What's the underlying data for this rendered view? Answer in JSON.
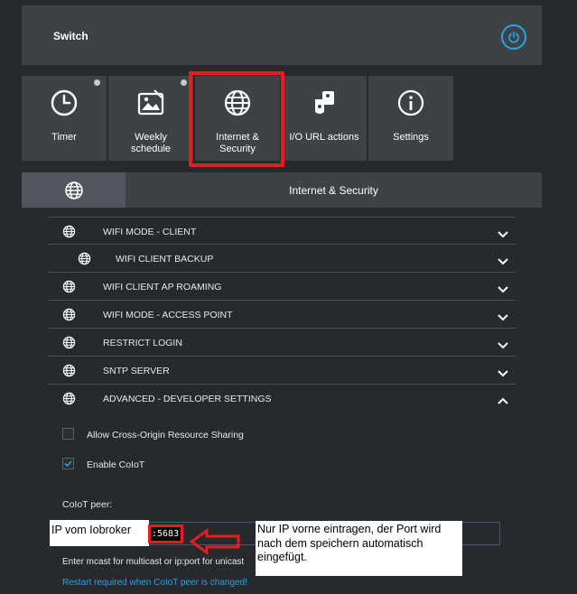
{
  "header": {
    "title": "Switch"
  },
  "tabs": [
    {
      "label": "Timer",
      "icon": "clock-icon",
      "dot": true
    },
    {
      "label": "Weekly schedule",
      "icon": "calendar-image-icon",
      "dot": true
    },
    {
      "label": "Internet & Security",
      "icon": "globe-icon",
      "dot": false,
      "active": true
    },
    {
      "label": "I/O URL actions",
      "icon": "io-url-icon",
      "dot": false
    },
    {
      "label": "Settings",
      "icon": "info-icon",
      "dot": false
    }
  ],
  "section": {
    "title": "Internet & Security",
    "icon": "globe-icon"
  },
  "rows": [
    {
      "label": "WIFI MODE - CLIENT",
      "chevron": "down"
    },
    {
      "label": "WIFI CLIENT BACKUP",
      "chevron": "down",
      "sub": true
    },
    {
      "label": "WIFI CLIENT AP ROAMING",
      "chevron": "down"
    },
    {
      "label": "WIFI MODE - ACCESS POINT",
      "chevron": "down"
    },
    {
      "label": "RESTRICT LOGIN",
      "chevron": "down"
    },
    {
      "label": "SNTP SERVER",
      "chevron": "down"
    },
    {
      "label": "ADVANCED - DEVELOPER SETTINGS",
      "chevron": "up"
    }
  ],
  "advanced": {
    "cors_label": "Allow Cross-Origin Resource Sharing",
    "cors_checked": false,
    "coiot_label": "Enable CoIoT",
    "coiot_checked": true,
    "peer_label": "CoIoT peer:",
    "peer_value": ":5683",
    "hint": "Enter mcast for multicast or ip:port for unicast",
    "restart": "Restart required when CoIoT peer is changed!"
  },
  "annotations": {
    "ip_note": "IP vom Iobroker",
    "port_note": "Nur IP vorne eintragen, der Port wird nach dem speichern automatisch eingefügt."
  },
  "colors": {
    "accent": "#2aa3e2",
    "highlight": "#e02020",
    "panel": "#3d4247",
    "background": "#262a2e"
  }
}
